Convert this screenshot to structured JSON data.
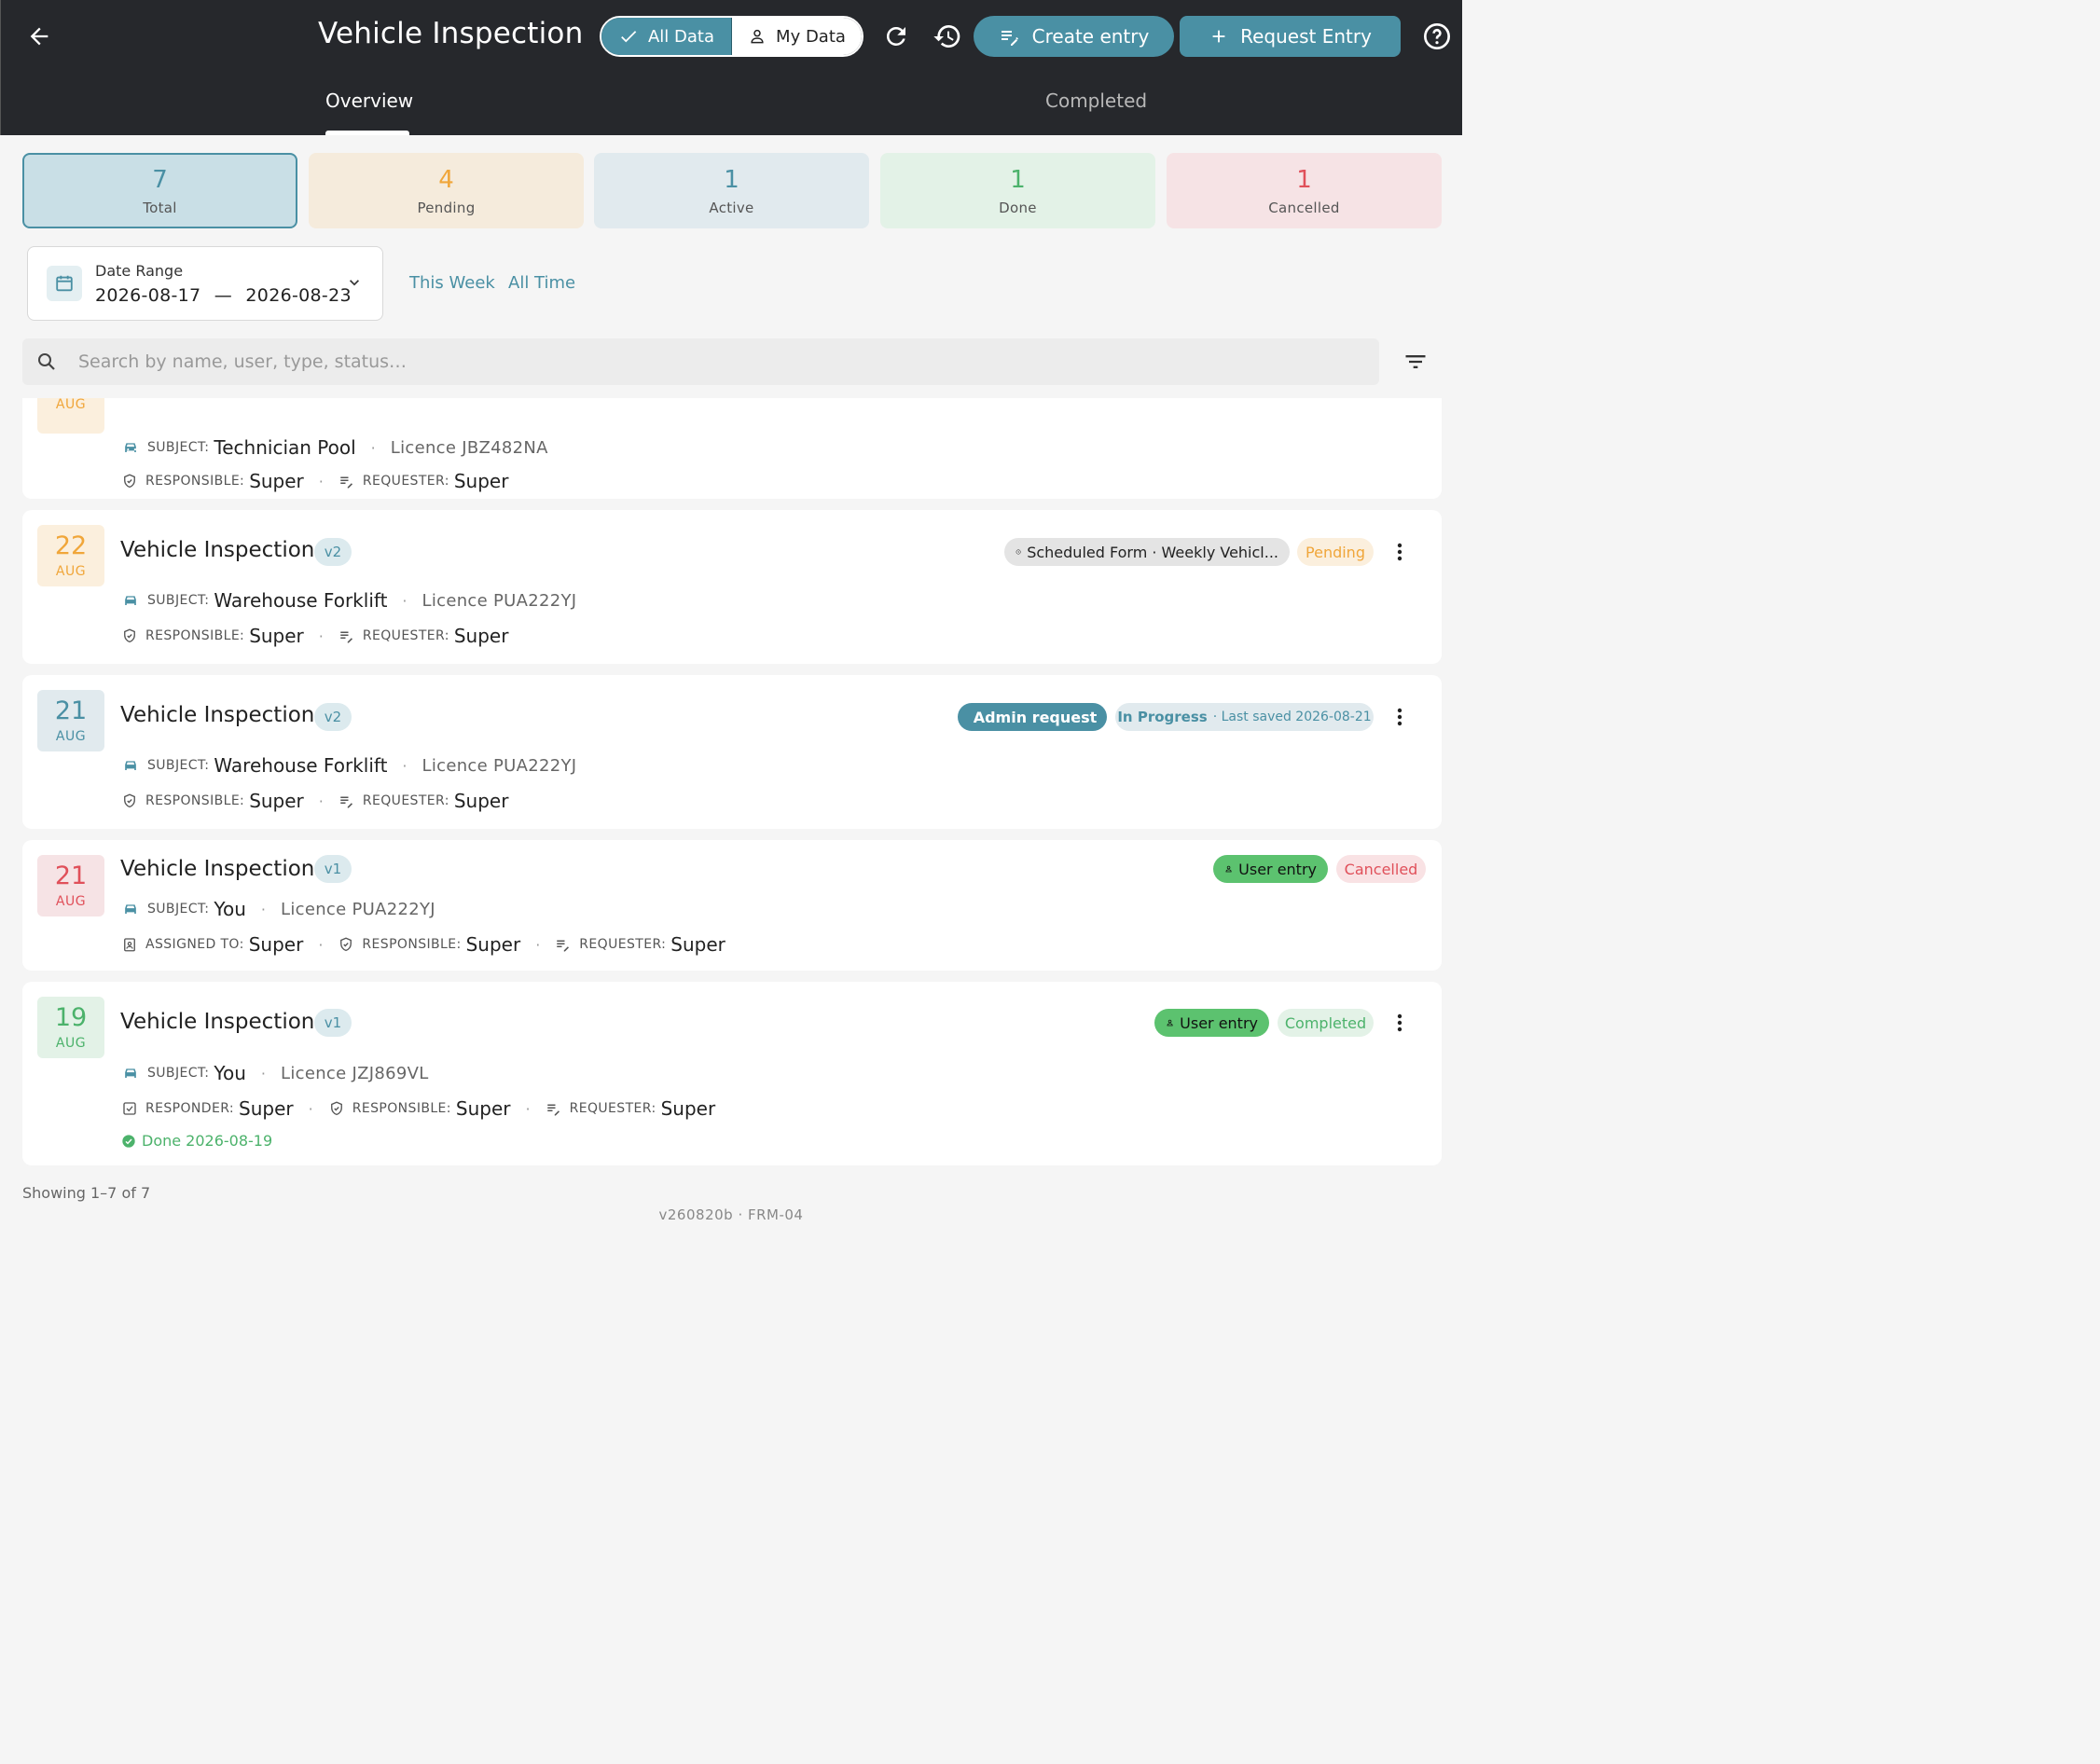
{
  "header": {
    "title": "Vehicle Inspection",
    "toggle": {
      "all_label": "All Data",
      "my_label": "My Data",
      "selected": "All Data"
    },
    "create_label": "Create entry",
    "request_label": "Request Entry",
    "accent_color": "#4a90a4",
    "bar_color": "#26282c"
  },
  "tabs": [
    {
      "label": "Overview",
      "active": true
    },
    {
      "label": "Completed",
      "active": false
    }
  ],
  "stats": [
    {
      "value": "7",
      "label": "Total",
      "color": "#4a90a4",
      "selected": true
    },
    {
      "value": "4",
      "label": "Pending",
      "color": "#f0a63a"
    },
    {
      "value": "1",
      "label": "Active",
      "color": "#4a90a4"
    },
    {
      "value": "1",
      "label": "Done",
      "color": "#4cb26b"
    },
    {
      "value": "1",
      "label": "Cancelled",
      "color": "#e0505a"
    }
  ],
  "date_range": {
    "label": "Date Range",
    "start": "2026-08-17",
    "separator": "—",
    "end": "2026-08-23"
  },
  "quick_filters": [
    "This Week",
    "All Time"
  ],
  "search": {
    "placeholder": "Search by name, user, type, status…",
    "value": ""
  },
  "entries": [
    {
      "day": "",
      "month": "AUG",
      "title": "",
      "subject_key": "SUBJECT:",
      "subject": "Technician Pool",
      "licence": "Licence JBZ482NA",
      "responsible_key": "RESPONSIBLE:",
      "responsible": "Super",
      "requester_key": "REQUESTER:",
      "requester": "Super"
    },
    {
      "day": "22",
      "month": "AUG",
      "title": "Vehicle Inspection",
      "version": "v2",
      "chip_source": "Scheduled Form · Weekly Vehicl...",
      "status": "Pending",
      "subject_key": "SUBJECT:",
      "subject": "Warehouse Forklift",
      "licence": "Licence PUA222YJ",
      "responsible_key": "RESPONSIBLE:",
      "responsible": "Super",
      "requester_key": "REQUESTER:",
      "requester": "Super"
    },
    {
      "day": "21",
      "month": "AUG",
      "title": "Vehicle Inspection",
      "version": "v2",
      "chip_source": "Admin request",
      "status": "In Progress",
      "status_note": "· Last saved 2026-08-21",
      "subject_key": "SUBJECT:",
      "subject": "Warehouse Forklift",
      "licence": "Licence PUA222YJ",
      "responsible_key": "RESPONSIBLE:",
      "responsible": "Super",
      "requester_key": "REQUESTER:",
      "requester": "Super"
    },
    {
      "day": "21",
      "month": "AUG",
      "title": "Vehicle Inspection",
      "version": "v1",
      "chip_source": "User entry",
      "status": "Cancelled",
      "subject_key": "SUBJECT:",
      "subject": "You",
      "licence": "Licence PUA222YJ",
      "assigned_key": "ASSIGNED TO:",
      "assigned": "Super",
      "responsible_key": "RESPONSIBLE:",
      "responsible": "Super",
      "requester_key": "REQUESTER:",
      "requester": "Super"
    },
    {
      "day": "19",
      "month": "AUG",
      "title": "Vehicle Inspection",
      "version": "v1",
      "chip_source": "User entry",
      "status": "Completed",
      "subject_key": "SUBJECT:",
      "subject": "You",
      "licence": "Licence JZJ869VL",
      "responder_key": "RESPONDER:",
      "responder": "Super",
      "responsible_key": "RESPONSIBLE:",
      "responsible": "Super",
      "requester_key": "REQUESTER:",
      "requester": "Super",
      "done_note": "Done 2026-08-19"
    }
  ],
  "footer": {
    "showing": "Showing 1–7 of 7",
    "version": "v260820b · FRM-04"
  }
}
